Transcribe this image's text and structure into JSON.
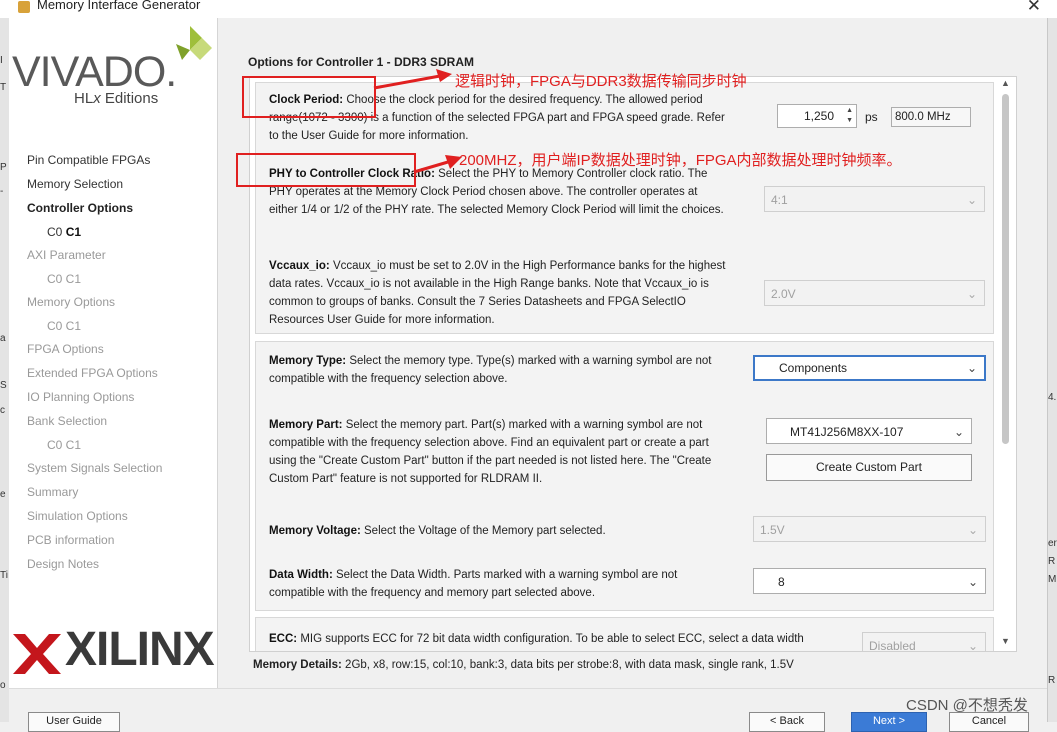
{
  "window": {
    "title": "Memory Interface Generator"
  },
  "sidebar": {
    "brand_main": "VIVADO.",
    "brand_sub_1": "HL",
    "brand_sub_x": "x",
    "brand_sub_2": " Editions",
    "xilinx": "XILINX",
    "nav": [
      {
        "label": "Pin Compatible FPGAs",
        "state": "done"
      },
      {
        "label": "Memory Selection",
        "state": "done"
      },
      {
        "label": "Controller Options",
        "state": "current"
      },
      {
        "label_a": "C0",
        "label_b": "C1",
        "state": "sub-active"
      },
      {
        "label": "AXI Parameter",
        "state": "pending"
      },
      {
        "label": "C0 C1",
        "state": "sub"
      },
      {
        "label": "Memory Options",
        "state": "pending"
      },
      {
        "label": "C0 C1",
        "state": "sub"
      },
      {
        "label": "FPGA Options",
        "state": "pending"
      },
      {
        "label": "Extended FPGA Options",
        "state": "pending"
      },
      {
        "label": "IO Planning Options",
        "state": "pending"
      },
      {
        "label": "Bank Selection",
        "state": "pending"
      },
      {
        "label": "C0 C1",
        "state": "sub"
      },
      {
        "label": "System Signals Selection",
        "state": "pending"
      },
      {
        "label": "Summary",
        "state": "pending"
      },
      {
        "label": "Simulation Options",
        "state": "pending"
      },
      {
        "label": "PCB information",
        "state": "pending"
      },
      {
        "label": "Design Notes",
        "state": "pending"
      }
    ]
  },
  "main": {
    "title": "Options for Controller 1 - DDR3 SDRAM",
    "clock": {
      "label": "Clock Period:",
      "text": "Choose the clock period for the desired frequency. The allowed period range(1072 - 3300) is a function of the selected FPGA part and FPGA speed grade. Refer to the User Guide for more information.",
      "value": "1,250",
      "unit": "ps",
      "freq": "800.0 MHz"
    },
    "phy": {
      "label": "PHY to Controller Clock Ratio:",
      "text": "Select the PHY to Memory Controller clock ratio. The PHY operates at the Memory Clock Period chosen above. The controller operates at either 1/4 or 1/2 of the PHY rate. The selected Memory Clock Period will limit the choices.",
      "value": "4:1"
    },
    "vccaux": {
      "label": "Vccaux_io:",
      "text": "Vccaux_io must be set to 2.0V in the High Performance banks for the highest data rates. Vccaux_io is not available in the High Range banks. Note that Vccaux_io is common to groups of banks. Consult the 7 Series Datasheets and FPGA SelectIO Resources User Guide for more information.",
      "value": "2.0V"
    },
    "memory_type": {
      "label": "Memory Type:",
      "text": "Select the memory type. Type(s) marked with a warning symbol are not compatible with the frequency selection above.",
      "value": "Components"
    },
    "memory_part": {
      "label": "Memory Part:",
      "text": "Select the memory part. Part(s) marked with a warning symbol are not compatible with the frequency selection above. Find an equivalent part or create a part using the \"Create Custom Part\" button if the part needed is not listed here. The \"Create Custom Part\" feature is not supported for RLDRAM II.",
      "value": "MT41J256M8XX-107",
      "custom_button": "Create Custom Part"
    },
    "voltage": {
      "label": "Memory Voltage:",
      "text": "Select the Voltage of the Memory part selected.",
      "value": "1.5V"
    },
    "width": {
      "label": "Data Width:",
      "text": "Select the Data Width. Parts marked with a warning symbol are not compatible with the frequency and memory part selected above.",
      "value": "8"
    },
    "ecc": {
      "label": "ECC:",
      "text": "MIG supports ECC for 72 bit data width configuration. To be able to select ECC, select a data width",
      "value": "Disabled"
    },
    "details_label": "Memory Details:",
    "details_text": "2Gb, x8, row:15, col:10, bank:3, data bits per strobe:8, with data mask, single rank, 1.5V"
  },
  "annotations": {
    "clock_note": "逻辑时钟，FPGA与DDR3数据传输同步时钟",
    "phy_note": "200MHZ，用户端IP数据处理时钟，FPGA内部数据处理时钟频率。",
    "color": "#e02020"
  },
  "footer": {
    "user_guide": "User Guide",
    "back": "< Back",
    "next": "Next >",
    "cancel": "Cancel"
  },
  "watermark": "CSDN @不想秃发"
}
